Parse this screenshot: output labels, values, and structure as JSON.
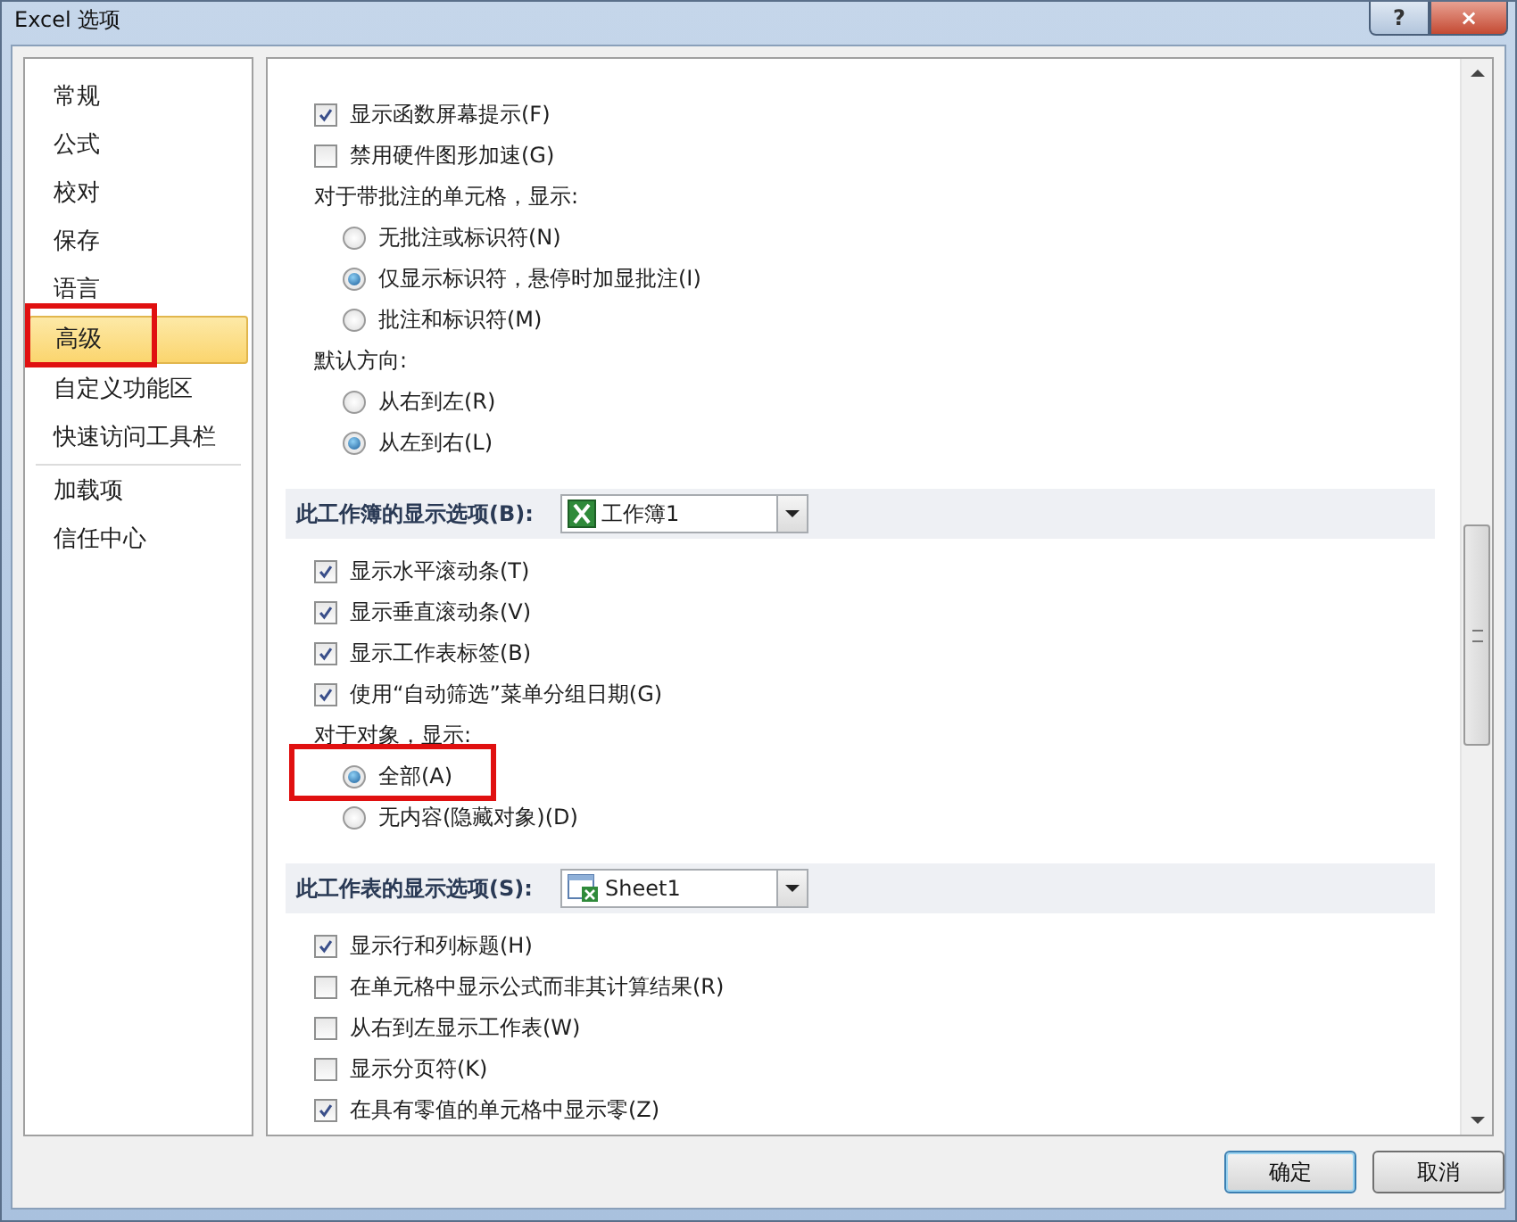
{
  "window": {
    "title": "Excel 选项",
    "help": "?",
    "close": "×"
  },
  "sidebar": {
    "groups": [
      {
        "items": [
          {
            "label": "常规",
            "selected": false
          },
          {
            "label": "公式",
            "selected": false
          },
          {
            "label": "校对",
            "selected": false
          },
          {
            "label": "保存",
            "selected": false
          },
          {
            "label": "语言",
            "selected": false
          },
          {
            "label": "高级",
            "selected": true,
            "highlighted": true
          },
          {
            "label": "自定义功能区",
            "selected": false
          },
          {
            "label": "快速访问工具栏",
            "selected": false
          }
        ]
      },
      {
        "items": [
          {
            "label": "加载项",
            "selected": false
          },
          {
            "label": "信任中心",
            "selected": false
          }
        ]
      }
    ]
  },
  "options": [
    {
      "kind": "checkbox",
      "label": "显示函数屏幕提示(F)",
      "checked": true
    },
    {
      "kind": "checkbox",
      "label": "禁用硬件图形加速(G)",
      "checked": false
    },
    {
      "kind": "label",
      "label": "对于带批注的单元格，显示:"
    },
    {
      "kind": "radio",
      "label": "无批注或标识符(N)",
      "selected": false
    },
    {
      "kind": "radio",
      "label": "仅显示标识符，悬停时加显批注(I)",
      "selected": true
    },
    {
      "kind": "radio",
      "label": "批注和标识符(M)",
      "selected": false
    },
    {
      "kind": "label",
      "label": "默认方向:"
    },
    {
      "kind": "radio",
      "label": "从右到左(R)",
      "selected": false
    },
    {
      "kind": "radio",
      "label": "从左到右(L)",
      "selected": true
    },
    {
      "kind": "workbook_section",
      "label": "此工作簿的显示选项(B):",
      "dropdown": "工作簿1"
    },
    {
      "kind": "checkbox",
      "label": "显示水平滚动条(T)",
      "checked": true
    },
    {
      "kind": "checkbox",
      "label": "显示垂直滚动条(V)",
      "checked": true
    },
    {
      "kind": "checkbox",
      "label": "显示工作表标签(B)",
      "checked": true
    },
    {
      "kind": "checkbox",
      "label": "使用“自动筛选”菜单分组日期(G)",
      "checked": true
    },
    {
      "kind": "label",
      "label": "对于对象，显示:"
    },
    {
      "kind": "radio",
      "label": "全部(A)",
      "selected": true,
      "highlighted": true
    },
    {
      "kind": "radio",
      "label": "无内容(隐藏对象)(D)",
      "selected": false
    },
    {
      "kind": "sheet_section",
      "label": "此工作表的显示选项(S):",
      "dropdown": "Sheet1"
    },
    {
      "kind": "checkbox",
      "label": "显示行和列标题(H)",
      "checked": true
    },
    {
      "kind": "checkbox",
      "label": "在单元格中显示公式而非其计算结果(R)",
      "checked": false
    },
    {
      "kind": "checkbox",
      "label": "从右到左显示工作表(W)",
      "checked": false
    },
    {
      "kind": "checkbox",
      "label": "显示分页符(K)",
      "checked": false
    },
    {
      "kind": "checkbox",
      "label": "在具有零值的单元格中显示零(Z)",
      "checked": true
    }
  ],
  "buttons": [
    {
      "label": "确定",
      "default": true
    },
    {
      "label": "取消",
      "default": false
    }
  ]
}
